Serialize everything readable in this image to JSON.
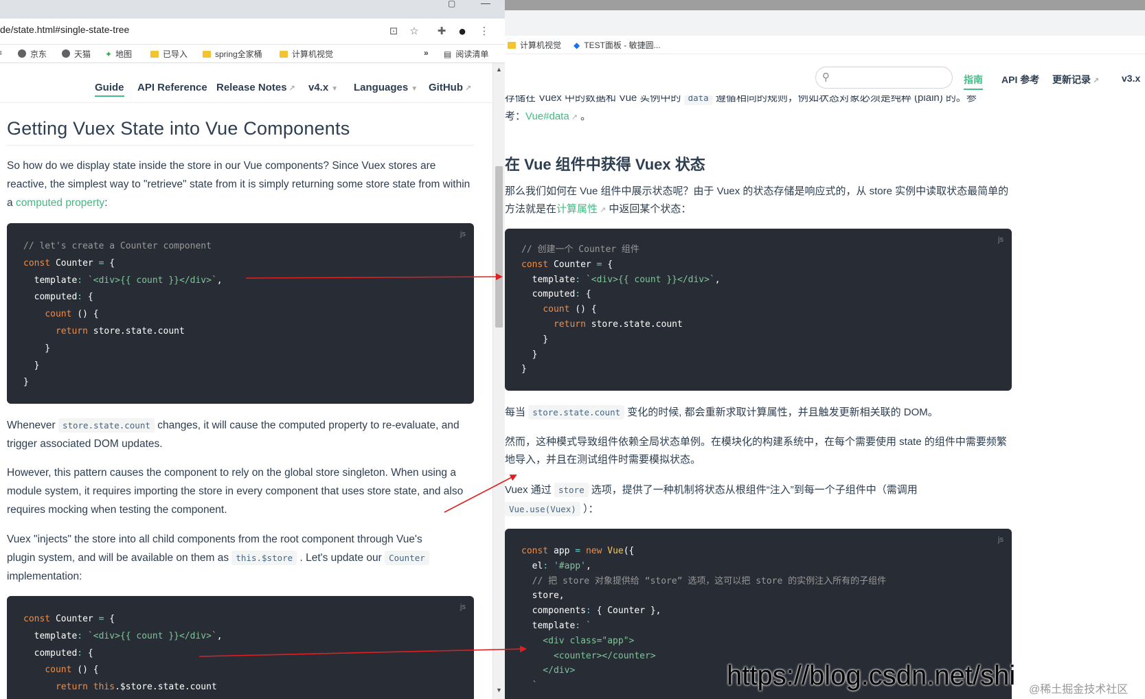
{
  "left": {
    "url": "de/state.html#single-state-tree",
    "bookmarks": [
      {
        "label": "京东",
        "icon": "globe-icon"
      },
      {
        "label": "天猫",
        "icon": "globe-icon"
      },
      {
        "label": "地图",
        "icon": "maps-icon"
      },
      {
        "label": "已导入",
        "icon": "folder-icon"
      },
      {
        "label": "spring全家桶",
        "icon": "folder-icon"
      },
      {
        "label": "计算机视觉",
        "icon": "folder-icon"
      }
    ],
    "bookmarks_more": "»",
    "reading_list": "阅读清单",
    "nav": {
      "guide": "Guide",
      "api": "API Reference",
      "release": "Release Notes",
      "version": "v4.x",
      "languages": "Languages",
      "github": "GitHub"
    },
    "heading": "Getting Vuex State into Vue Components",
    "p1_a": "So how do we display state inside the store in our Vue components? Since Vuex stores are reactive, the simplest way to \"retrieve\" state from it is simply returning some store state from within a ",
    "p1_link": "computed property",
    "p1_b": ":",
    "code_lang": "js",
    "p2_a": "Whenever ",
    "p2_code": "store.state.count",
    "p2_b": " changes, it will cause the computed property to re-evaluate, and trigger associated DOM updates.",
    "p3": "However, this pattern causes the component to rely on the global store singleton. When using a module system, it requires importing the store in every component that uses store state, and also requires mocking when testing the component.",
    "p4_a": "Vuex \"injects\" the store into all child components from the root component through Vue's plugin system, and will be available on them as ",
    "p4_code1": "this.$store",
    "p4_b": " . Let's update our ",
    "p4_code2": "Counter",
    "p4_c": "implementation:"
  },
  "right": {
    "bookmarks": [
      {
        "label": "计算机视觉",
        "icon": "folder-icon"
      },
      {
        "label": "TEST面板 - 敏捷圆...",
        "icon": "diamond-icon"
      }
    ],
    "nav": {
      "guide": "指南",
      "api": "API 参考",
      "changelog": "更新记录",
      "version": "v3.x"
    },
    "top_partial": "存储在 Vuex 中的数据和 Vue 实例中的",
    "top_partial_code": "data",
    "top_partial_b": "遵循相同的规则，例如状态对象必须是纯粹 (plain) 的。参",
    "top_line2_a": "考：",
    "top_line2_link": "Vue#data",
    "top_line2_b": "。",
    "heading": "在 Vue 组件中获得 Vuex 状态",
    "p1_a": "那么我们如何在 Vue 组件中展示状态呢？由于 Vuex 的状态存储是响应式的，从 store 实例中读取状态最简单的方法就是在",
    "p1_link": "计算属性",
    "p1_b": "中返回某个状态：",
    "code_lang": "js",
    "p2_a": "每当",
    "p2_code": "store.state.count",
    "p2_b": "变化的时候, 都会重新求取计算属性，并且触发更新相关联的 DOM。",
    "p3": "然而，这种模式导致组件依赖全局状态单例。在模块化的构建系统中，在每个需要使用 state 的组件中需要频繁地导入，并且在测试组件时需要模拟状态。",
    "p4_a": "Vuex 通过",
    "p4_code1": "store",
    "p4_b": "选项，提供了一种机制将状态从根组件“注入”到每一个子组件中（需调用",
    "p4_code2": "Vue.use(Vuex)",
    "p4_c": "）："
  },
  "watermark_csdn": "https://blog.csdn.net/shi",
  "watermark_juejin": "@稀土掘金技术社区",
  "colors": {
    "accent": "#46bd87",
    "link": "#42b983",
    "code_bg": "#282c34",
    "arrow": "#e02020"
  }
}
